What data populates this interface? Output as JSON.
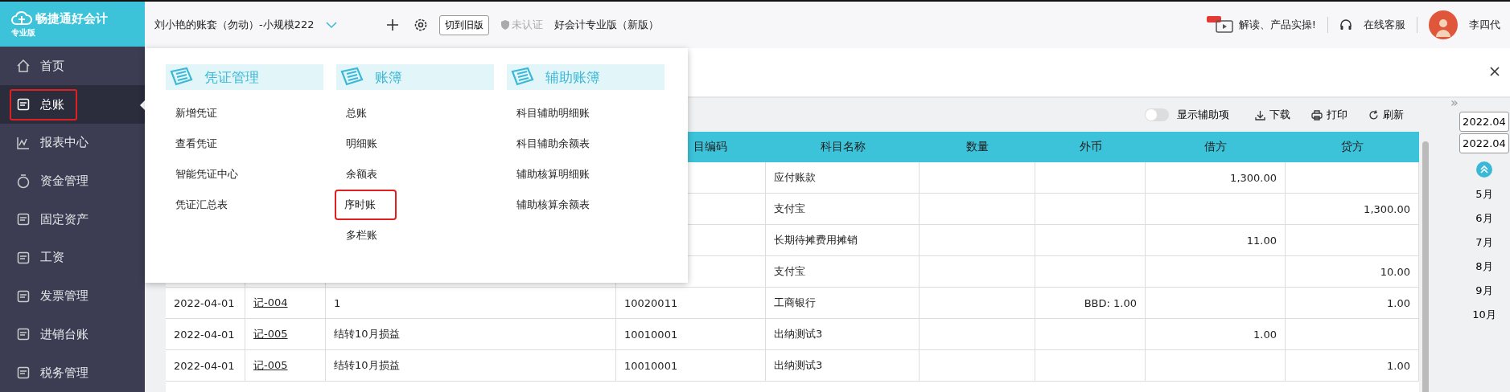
{
  "brand": {
    "name": "畅捷通好会计",
    "edition": "专业版"
  },
  "topbar": {
    "account": "刘小艳的账套（勿动）-小规模222",
    "old_version_button": "切到旧版",
    "auth_status": "未认证",
    "product": "好会计专业版（新版）",
    "promo": "解读、产品实操!",
    "support": "在线客服",
    "user": "李四代"
  },
  "sidebar": {
    "items": [
      {
        "label": "首页",
        "selected": false,
        "highlighted": false
      },
      {
        "label": "总账",
        "selected": true,
        "highlighted": true
      },
      {
        "label": "报表中心",
        "selected": false,
        "highlighted": false
      },
      {
        "label": "资金管理",
        "selected": false,
        "highlighted": false
      },
      {
        "label": "固定资产",
        "selected": false,
        "highlighted": false
      },
      {
        "label": "工资",
        "selected": false,
        "highlighted": false
      },
      {
        "label": "发票管理",
        "selected": false,
        "highlighted": false
      },
      {
        "label": "进销台账",
        "selected": false,
        "highlighted": false
      },
      {
        "label": "税务管理",
        "selected": false,
        "highlighted": false
      }
    ]
  },
  "menu": {
    "sections": [
      {
        "title": "凭证管理",
        "items": [
          {
            "label": "新增凭证",
            "highlighted": false
          },
          {
            "label": "查看凭证",
            "highlighted": false
          },
          {
            "label": "智能凭证中心",
            "highlighted": false
          },
          {
            "label": "凭证汇总表",
            "highlighted": false
          }
        ]
      },
      {
        "title": "账簿",
        "items": [
          {
            "label": "总账",
            "highlighted": false
          },
          {
            "label": "明细账",
            "highlighted": false
          },
          {
            "label": "余额表",
            "highlighted": false
          },
          {
            "label": "序时账",
            "highlighted": true
          },
          {
            "label": "多栏账",
            "highlighted": false
          }
        ]
      },
      {
        "title": "辅助账簿",
        "items": [
          {
            "label": "科目辅助明细账",
            "highlighted": false
          },
          {
            "label": "科目辅助余额表",
            "highlighted": false
          },
          {
            "label": "辅助核算明细账",
            "highlighted": false
          },
          {
            "label": "辅助核算余额表",
            "highlighted": false
          }
        ]
      }
    ]
  },
  "toolbar": {
    "toggle": {
      "label": "显示辅助项",
      "on": false
    },
    "download": "下载",
    "print": "打印",
    "refresh": "刷新"
  },
  "table": {
    "columns": [
      "",
      "",
      "",
      "目编码",
      "科目名称",
      "数量",
      "外币",
      "借方",
      "贷方"
    ],
    "rows": [
      {
        "date": "",
        "voucher": "",
        "summary": "",
        "code": "",
        "account": "应付账款",
        "quantity": "",
        "foreign": "",
        "debit": "1,300.00",
        "credit": ""
      },
      {
        "date": "",
        "voucher": "",
        "summary": "",
        "code": "",
        "account": "支付宝",
        "quantity": "",
        "foreign": "",
        "debit": "",
        "credit": "1,300.00"
      },
      {
        "date": "",
        "voucher": "",
        "summary": "",
        "code": "",
        "account": "长期待摊费用摊销",
        "quantity": "",
        "foreign": "",
        "debit": "11.00",
        "credit": ""
      },
      {
        "date": "",
        "voucher": "",
        "summary": "",
        "code": "",
        "account": "支付宝",
        "quantity": "",
        "foreign": "",
        "debit": "",
        "credit": "10.00"
      },
      {
        "date": "2022-04-01",
        "voucher": "记-004",
        "summary": "1",
        "code": "10020011",
        "account": "工商银行",
        "quantity": "",
        "foreign": "BBD: 1.00",
        "debit": "",
        "credit": "1.00"
      },
      {
        "date": "2022-04-01",
        "voucher": "记-005",
        "summary": "结转10月损益",
        "code": "10010001",
        "account": "出纳测试3",
        "quantity": "",
        "foreign": "",
        "debit": "1.00",
        "credit": ""
      },
      {
        "date": "2022-04-01",
        "voucher": "记-005",
        "summary": "结转10月损益",
        "code": "10010001",
        "account": "出纳测试3",
        "quantity": "",
        "foreign": "",
        "debit": "",
        "credit": "1.00"
      }
    ]
  },
  "period_panel": {
    "expand": "»",
    "start": "2022.04",
    "end": "2022.04",
    "months": [
      "5月",
      "6月",
      "7月",
      "8月",
      "9月",
      "10月"
    ]
  }
}
